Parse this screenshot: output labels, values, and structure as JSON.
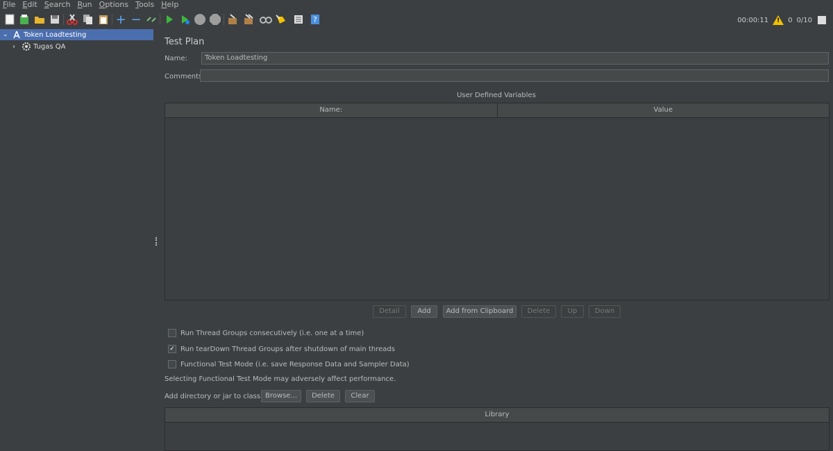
{
  "menu": [
    {
      "underline": "F",
      "rest": "ile"
    },
    {
      "underline": "E",
      "rest": "dit"
    },
    {
      "underline": "S",
      "rest": "earch"
    },
    {
      "underline": "R",
      "rest": "un"
    },
    {
      "underline": "O",
      "rest": "ptions"
    },
    {
      "underline": "T",
      "rest": "ools"
    },
    {
      "underline": "H",
      "rest": "elp"
    }
  ],
  "toolbar": {
    "icons": [
      "new-icon",
      "templates-icon",
      "open-icon",
      "save-icon",
      "cut-icon",
      "copy-icon",
      "paste-icon",
      "expand-icon",
      "collapse-icon",
      "toggle-icon",
      "start-icon",
      "start-no-pause-icon",
      "stop-icon",
      "shutdown-icon",
      "clear-icon",
      "clear-all-icon",
      "search-icon",
      "reset-search-icon",
      "function-helper-icon",
      "help-icon"
    ]
  },
  "status": {
    "time": "00:00:11",
    "warnings": "0",
    "threads": "0/10"
  },
  "tree": {
    "root": "Token Loadtesting",
    "child": "Tugas QA"
  },
  "panel": {
    "title": "Test Plan",
    "name_label": "Name:",
    "name_value": "Token Loadtesting",
    "comments_label": "Comments:",
    "comments_value": "",
    "udv_title": "User Defined Variables",
    "col_name": "Name:",
    "col_value": "Value"
  },
  "buttons": {
    "detail": "Detail",
    "add": "Add",
    "add_clipboard": "Add from Clipboard",
    "delete": "Delete",
    "up": "Up",
    "down": "Down"
  },
  "options": {
    "consecutive": "Run Thread Groups consecutively (i.e. one at a time)",
    "teardown": "Run tearDown Thread Groups after shutdown of main threads",
    "functional": "Functional Test Mode (i.e. save Response Data and Sampler Data)",
    "functional_note": "Selecting Functional Test Mode may adversely affect performance."
  },
  "classpath": {
    "label": "Add directory or jar to classpath",
    "browse": "Browse...",
    "delete": "Delete",
    "clear": "Clear",
    "library_header": "Library"
  }
}
